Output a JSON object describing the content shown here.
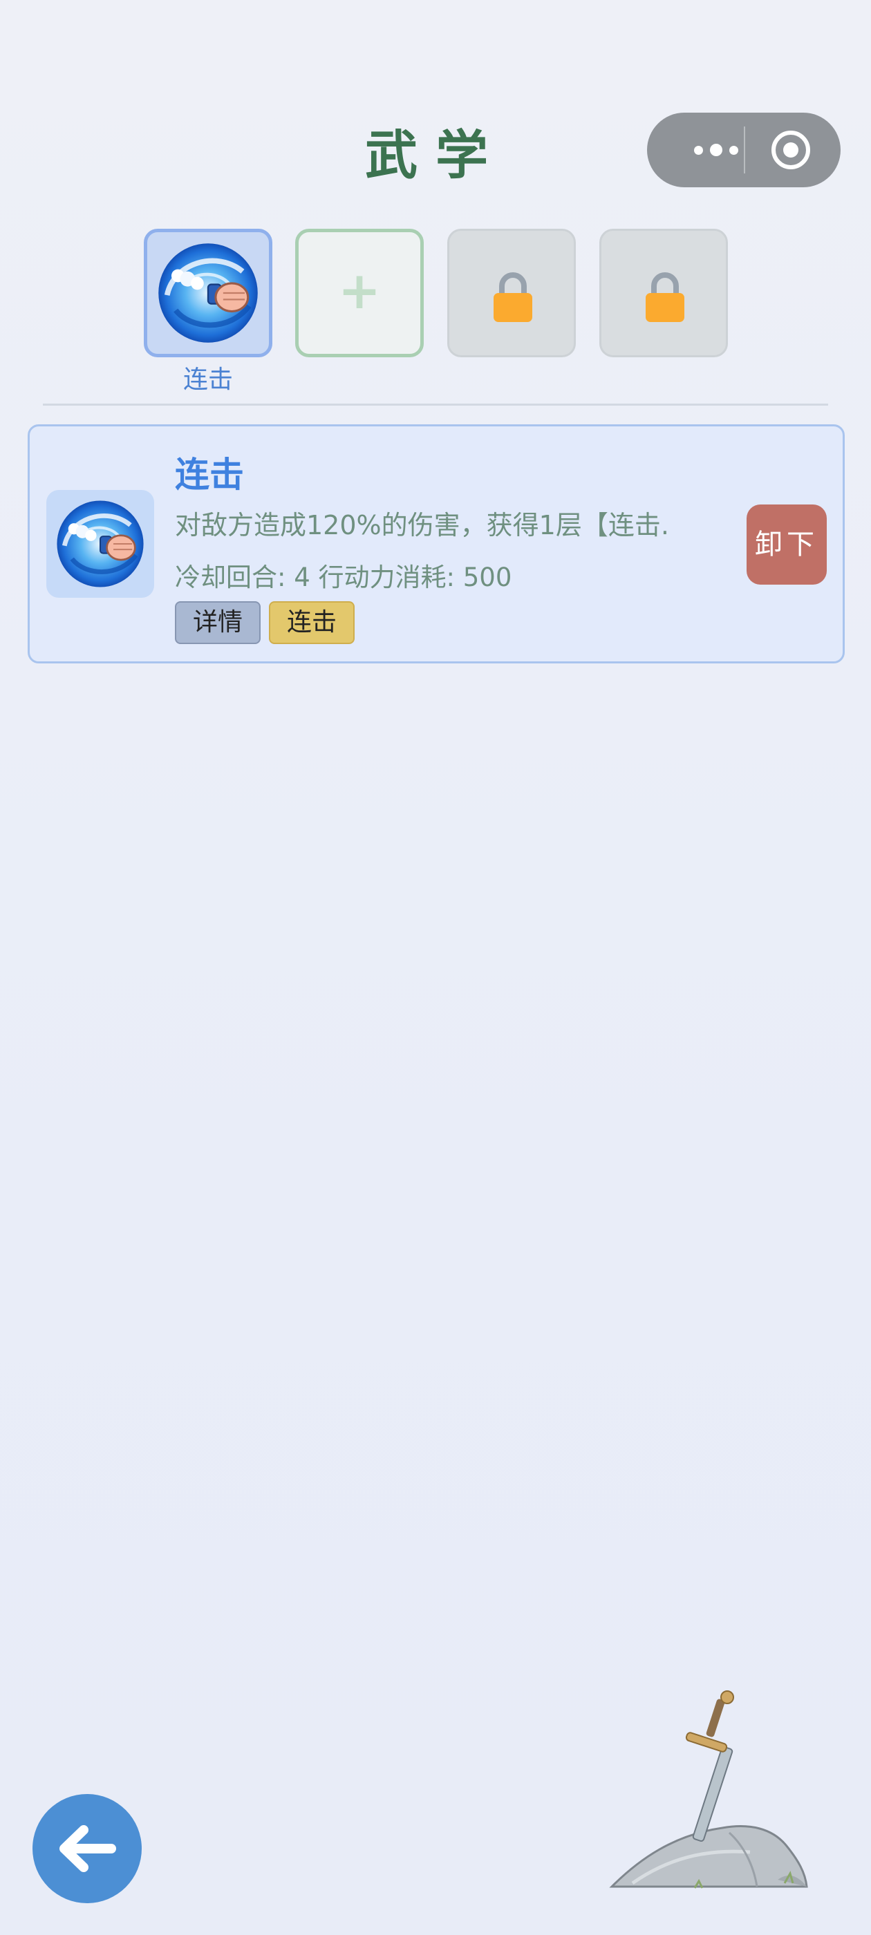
{
  "header": {
    "title": "武学"
  },
  "capsule": {
    "more_icon": "more-dots-icon",
    "close_icon": "target-circle-icon"
  },
  "slots": [
    {
      "state": "equipped",
      "label": "连击",
      "icon": "whirlwind-fist-icon"
    },
    {
      "state": "empty",
      "symbol": "+",
      "icon": "plus-icon"
    },
    {
      "state": "locked",
      "icon": "lock-icon"
    },
    {
      "state": "locked",
      "icon": "lock-icon"
    }
  ],
  "skill_card": {
    "name": "连击",
    "description": "对敌方造成120%的伤害，获得1层【连击.",
    "stats": "冷却回合: 4  行动力消耗: 500",
    "tags": {
      "detail": "详情",
      "type": "连击"
    },
    "unload_label": "卸下"
  },
  "footer": {
    "back_icon": "arrow-left-icon",
    "decoration_icon": "sword-in-stone-icon"
  },
  "colors": {
    "title": "#3c7350",
    "accent_blue": "#3f81df",
    "unload_red": "#c07066",
    "tag_yellow": "#e3c86c",
    "back_button": "#4c8fd4"
  }
}
